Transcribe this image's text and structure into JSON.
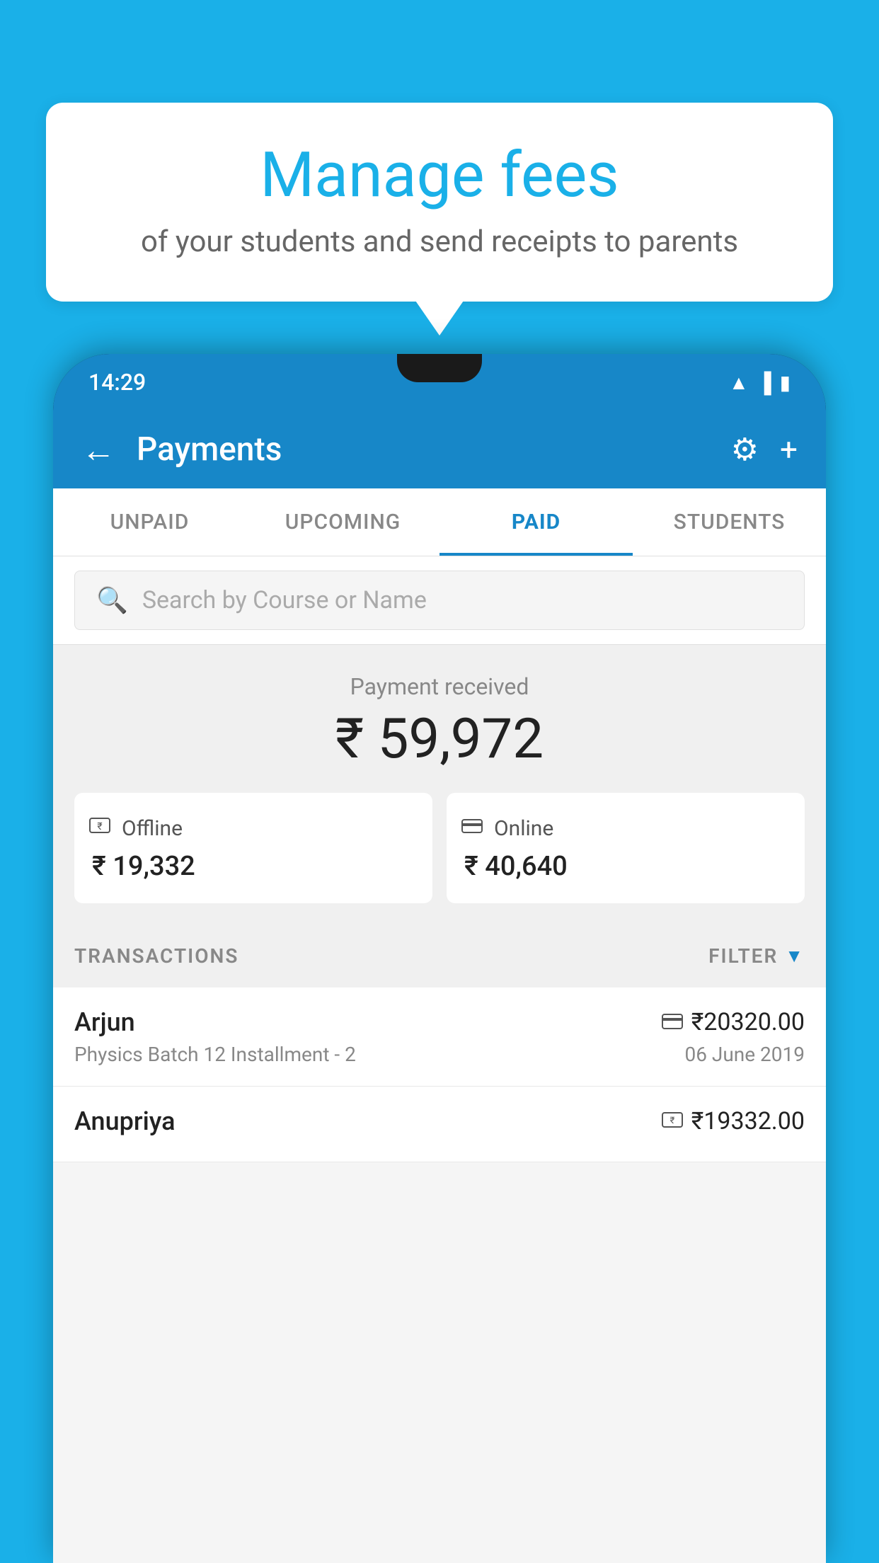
{
  "background_color": "#1ab0e8",
  "speech_bubble": {
    "title": "Manage fees",
    "subtitle": "of your students and send receipts to parents"
  },
  "status_bar": {
    "time": "14:29",
    "icons": [
      "wifi",
      "signal",
      "battery"
    ]
  },
  "app_header": {
    "title": "Payments",
    "back_label": "←",
    "gear_icon": "⚙",
    "plus_icon": "+"
  },
  "tabs": [
    {
      "label": "UNPAID",
      "active": false
    },
    {
      "label": "UPCOMING",
      "active": false
    },
    {
      "label": "PAID",
      "active": true
    },
    {
      "label": "STUDENTS",
      "active": false
    }
  ],
  "search": {
    "placeholder": "Search by Course or Name"
  },
  "payment_summary": {
    "label": "Payment received",
    "amount": "₹ 59,972",
    "offline": {
      "icon": "💳",
      "label": "Offline",
      "amount": "₹ 19,332"
    },
    "online": {
      "icon": "💳",
      "label": "Online",
      "amount": "₹ 40,640"
    }
  },
  "transactions_header": {
    "label": "TRANSACTIONS",
    "filter_label": "FILTER"
  },
  "transactions": [
    {
      "name": "Arjun",
      "type_icon": "card",
      "amount": "₹20320.00",
      "description": "Physics Batch 12 Installment - 2",
      "date": "06 June 2019"
    },
    {
      "name": "Anupriya",
      "type_icon": "cash",
      "amount": "₹19332.00",
      "description": "",
      "date": ""
    }
  ]
}
